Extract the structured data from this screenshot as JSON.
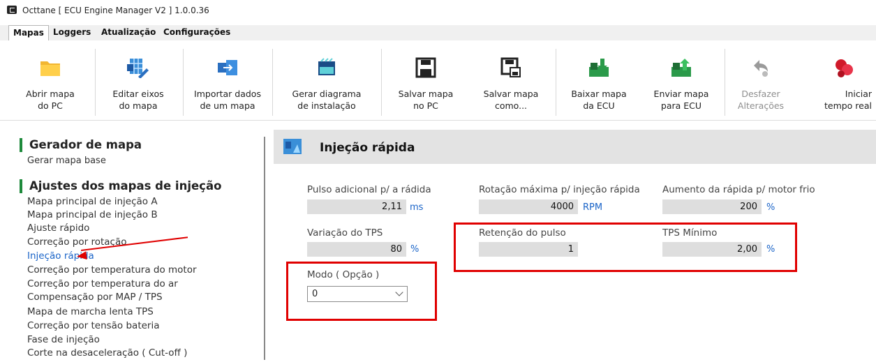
{
  "window": {
    "title": "Octtane [ ECU Engine Manager V2 ] 1.0.0.36"
  },
  "menu": {
    "tabs": [
      "Mapas",
      "Loggers",
      "Atualização",
      "Configurações"
    ]
  },
  "ribbon": {
    "buttons": [
      {
        "line1": "Abrir mapa",
        "line2": "do PC",
        "icon": "folder-icon"
      },
      {
        "line1": "Editar eixos",
        "line2": "do mapa",
        "icon": "edit-axes-icon"
      },
      {
        "line1": "Importar dados",
        "line2": "de um mapa",
        "icon": "import-icon"
      },
      {
        "line1": "Gerar diagrama",
        "line2": "de instalação",
        "icon": "diagram-icon"
      },
      {
        "line1": "Salvar mapa",
        "line2": "no PC",
        "icon": "save-icon"
      },
      {
        "line1": "Salvar mapa",
        "line2": "como...",
        "icon": "save-as-icon"
      },
      {
        "line1": "Baixar mapa",
        "line2": "da ECU",
        "icon": "download-icon"
      },
      {
        "line1": "Enviar mapa",
        "line2": "para ECU",
        "icon": "upload-icon"
      },
      {
        "line1": "Desfazer",
        "line2": "Alterações",
        "icon": "undo-icon"
      },
      {
        "line1": "Iniciar",
        "line2": "tempo real",
        "icon": "realtime-icon"
      }
    ]
  },
  "nav": {
    "section1": {
      "title": "Gerador de mapa",
      "sub": "Gerar mapa base"
    },
    "section2": {
      "title": "Ajustes dos mapas de injeção",
      "items": [
        "Mapa principal de injeção A",
        "Mapa principal de injeção B",
        "Ajuste rápido",
        "Correção por rotação",
        "Injeção rápida",
        "Correção por temperatura do motor",
        "Correção por temperatura do ar",
        "Compensação por MAP / TPS",
        "Mapa de marcha lenta TPS",
        "Correção por tensão bateria",
        "Fase de injeção",
        "Corte na desaceleração ( Cut-off )"
      ],
      "active_item": "Injeção rápida"
    }
  },
  "panel": {
    "title": "Injeção rápida",
    "fields": {
      "pulso": {
        "label": "Pulso adicional p/ a rádida",
        "value": "2,11",
        "unit": "ms"
      },
      "rotacao": {
        "label": "Rotação máxima p/ injeção rápida",
        "value": "4000",
        "unit": "RPM"
      },
      "aumento": {
        "label": "Aumento da rápida p/ motor frio",
        "value": "200",
        "unit": "%"
      },
      "tps": {
        "label": "Variação do TPS",
        "value": "80",
        "unit": "%"
      },
      "retencao": {
        "label": "Retenção do pulso",
        "value": "1"
      },
      "tpsmin": {
        "label": "TPS Mínimo",
        "value": "2,00",
        "unit": "%"
      },
      "modo": {
        "label": "Modo ( Opção )",
        "value": "0"
      }
    }
  },
  "colors": {
    "accent_green": "#1e8a3c",
    "link_blue": "#1a64c8",
    "highlight_red": "#e00000"
  }
}
